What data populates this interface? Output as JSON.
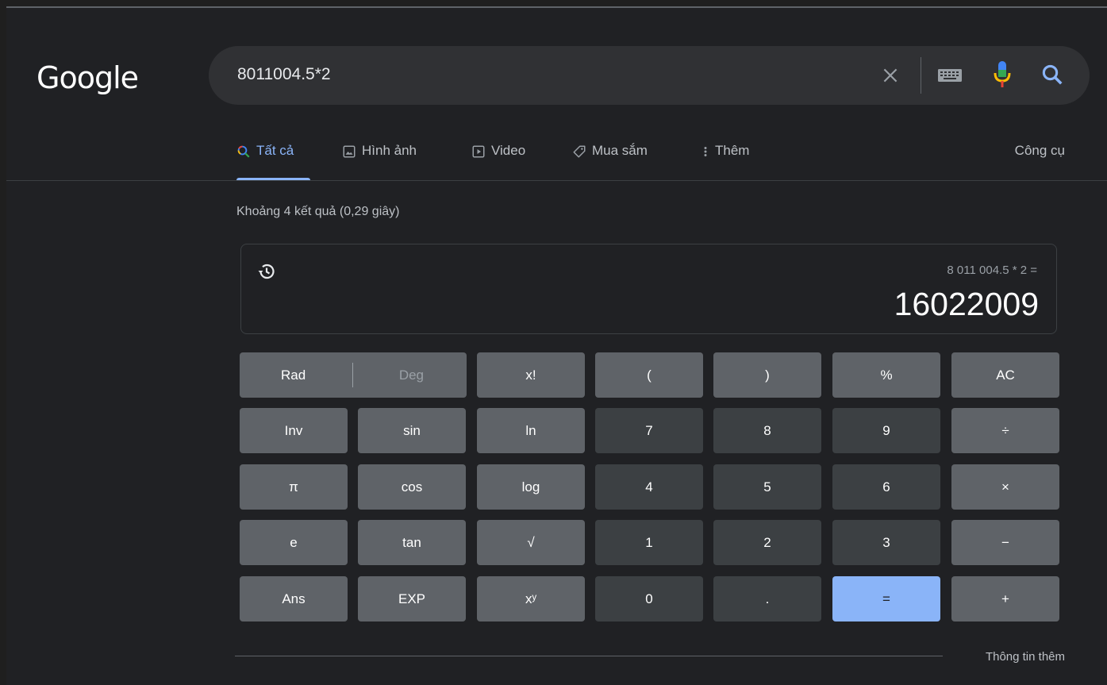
{
  "logo": {
    "text": "Google"
  },
  "search": {
    "query": "8011004.5*2"
  },
  "tabs": {
    "all": "Tất cả",
    "images": "Hình ảnh",
    "video": "Video",
    "shopping": "Mua sắm",
    "more": "Thêm",
    "tools": "Công cụ"
  },
  "result_stats": "Khoảng 4 kết quả (0,29 giây)",
  "calculator": {
    "expression": "8 011 004.5 * 2 =",
    "result": "16022009",
    "keys": {
      "rad": "Rad",
      "deg": "Deg",
      "fact": "x!",
      "lparen": "(",
      "rparen": ")",
      "percent": "%",
      "ac": "AC",
      "inv": "Inv",
      "sin": "sin",
      "ln": "ln",
      "k7": "7",
      "k8": "8",
      "k9": "9",
      "divide": "÷",
      "pi": "π",
      "cos": "cos",
      "log": "log",
      "k4": "4",
      "k5": "5",
      "k6": "6",
      "multiply": "×",
      "e": "e",
      "tan": "tan",
      "sqrt": "√",
      "k1": "1",
      "k2": "2",
      "k3": "3",
      "minus": "−",
      "ans": "Ans",
      "exp": "EXP",
      "pow": "xʸ",
      "k0": "0",
      "dot": ".",
      "equals": "=",
      "plus": "+"
    }
  },
  "more_info": "Thông tin thêm",
  "colors": {
    "accent": "#8ab4f8",
    "background": "#202124",
    "key_fn": "#5f6368",
    "key_num": "#3c4043"
  }
}
